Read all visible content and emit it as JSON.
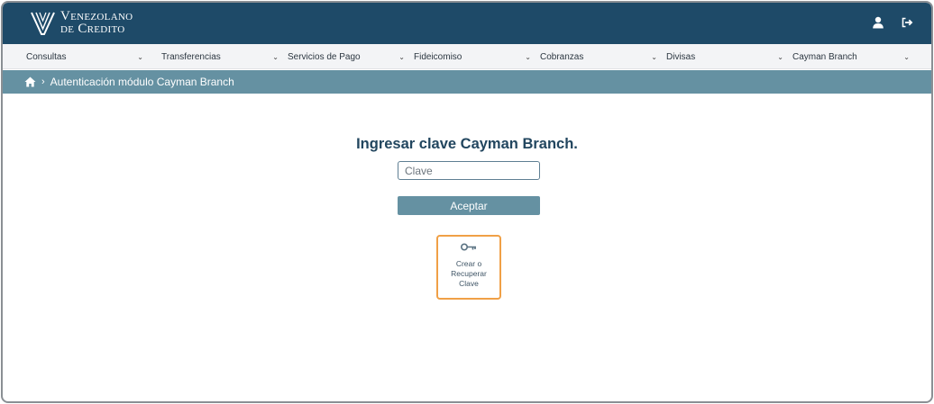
{
  "brand": {
    "line1": "Venezolano",
    "line2": "de Credito"
  },
  "header_icons": [
    "user-icon",
    "logout-icon"
  ],
  "menu": [
    {
      "label": "Consultas"
    },
    {
      "label": "Transferencias"
    },
    {
      "label": "Servicios de Pago"
    },
    {
      "label": "Fideicomiso"
    },
    {
      "label": "Cobranzas"
    },
    {
      "label": "Divisas"
    },
    {
      "label": "Cayman Branch"
    }
  ],
  "breadcrumb": {
    "separator": "›",
    "current": "Autenticación módulo Cayman Branch"
  },
  "main": {
    "title": "Ingresar clave Cayman Branch.",
    "password_placeholder": "Clave",
    "submit_label": "Aceptar",
    "recover": {
      "label": "Crear o Recuperar Clave",
      "icon": "key-icon"
    }
  },
  "colors": {
    "header": "#1e4a68",
    "breadcrumb": "#6591a2",
    "accent_border": "#f0a046",
    "title": "#22465f"
  }
}
